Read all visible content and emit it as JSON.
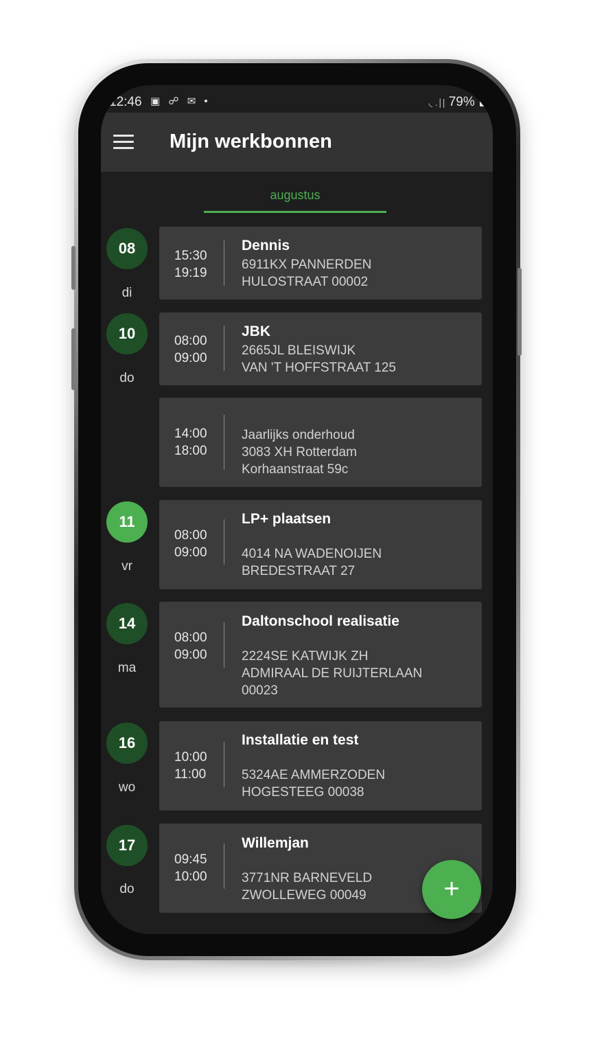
{
  "status_bar": {
    "time": "12:46",
    "notification_icons": "▣ ☍ ✉ •",
    "signal_text": "◟ .∣|",
    "battery": "79%"
  },
  "app_bar": {
    "title": "Mijn werkbonnen",
    "menu_icon": "hamburger-menu-icon"
  },
  "month_tab": "augustus",
  "colors": {
    "accent": "#4caf50",
    "date_circle": "#1f4f26",
    "card_bg": "#3c3c3c",
    "app_bar": "#333333",
    "background": "#1e1e1e"
  },
  "appointments": [
    {
      "date": "08",
      "day": "di",
      "start": "15:30",
      "end": "19:19",
      "title": "Dennis",
      "lines": [
        "6911KX PANNERDEN",
        "HULOSTRAAT 00002"
      ]
    },
    {
      "date": "10",
      "day": "do",
      "start": "08:00",
      "end": "09:00",
      "title": "JBK",
      "lines": [
        "2665JL BLEISWIJK",
        "VAN 'T HOFFSTRAAT 125"
      ]
    },
    {
      "date": "",
      "day": "",
      "start": "14:00",
      "end": "18:00",
      "title": "",
      "lines": [
        "Jaarlijks onderhoud",
        "3083 XH Rotterdam",
        "Korhaanstraat 59c"
      ]
    },
    {
      "date": "11",
      "day": "vr",
      "start": "08:00",
      "end": "09:00",
      "title": "LP+ plaatsen",
      "lines": [
        "4014 NA WADENOIJEN",
        "BREDESTRAAT 27"
      ],
      "today": true
    },
    {
      "date": "14",
      "day": "ma",
      "start": "08:00",
      "end": "09:00",
      "title": "Daltonschool realisatie",
      "lines": [
        "2224SE KATWIJK ZH",
        "ADMIRAAL DE RUIJTERLAAN",
        "00023"
      ]
    },
    {
      "date": "16",
      "day": "wo",
      "start": "10:00",
      "end": "11:00",
      "title": "Installatie en test",
      "lines": [
        "5324AE AMMERZODEN",
        "HOGESTEEG 00038"
      ]
    },
    {
      "date": "17",
      "day": "do",
      "start": "09:45",
      "end": "10:00",
      "title": "Willemjan",
      "lines": [
        "3771NR BARNEVELD",
        "ZWOLLEWEG 00049"
      ]
    }
  ],
  "fab": {
    "label": "+",
    "icon": "plus-icon"
  }
}
